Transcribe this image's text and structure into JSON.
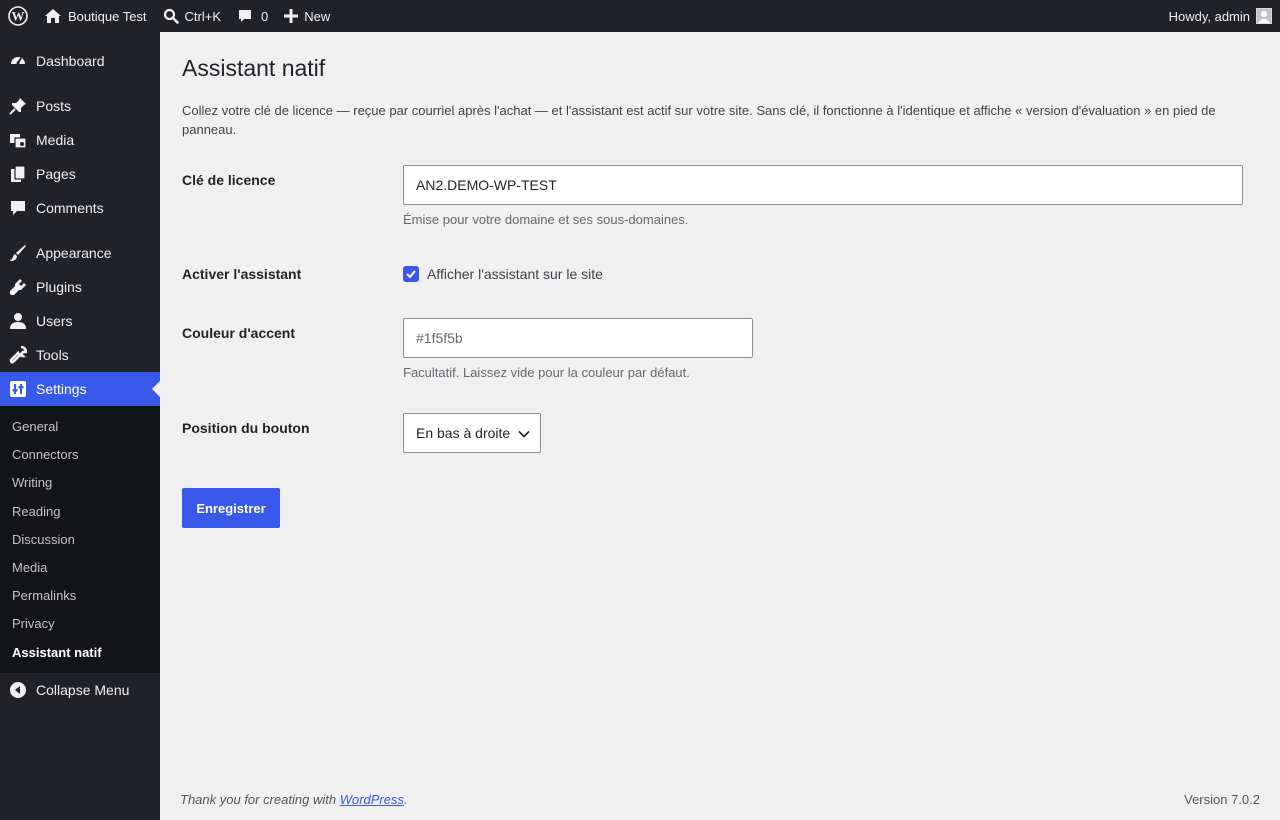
{
  "adminbar": {
    "site_name": "Boutique Test",
    "search_shortcut": "Ctrl+K",
    "comments_count": "0",
    "new_label": "New",
    "howdy": "Howdy, admin"
  },
  "sidebar": {
    "items": [
      {
        "label": "Dashboard",
        "icon": "dashboard-icon"
      },
      {
        "label": "Posts",
        "icon": "pin-icon"
      },
      {
        "label": "Media",
        "icon": "media-icon"
      },
      {
        "label": "Pages",
        "icon": "pages-icon"
      },
      {
        "label": "Comments",
        "icon": "comment-icon"
      },
      {
        "label": "Appearance",
        "icon": "brush-icon"
      },
      {
        "label": "Plugins",
        "icon": "plugin-icon"
      },
      {
        "label": "Users",
        "icon": "user-icon"
      },
      {
        "label": "Tools",
        "icon": "wrench-icon"
      },
      {
        "label": "Settings",
        "icon": "settings-icon"
      }
    ],
    "submenu": [
      "General",
      "Connectors",
      "Writing",
      "Reading",
      "Discussion",
      "Media",
      "Permalinks",
      "Privacy",
      "Assistant natif"
    ],
    "collapse": "Collapse Menu"
  },
  "page": {
    "title": "Assistant natif",
    "intro": "Collez votre clé de licence — reçue par courriel après l'achat — et l'assistant est actif sur votre site. Sans clé, il fonctionne à l'identique et affiche « version d'évaluation » en pied de panneau."
  },
  "form": {
    "license": {
      "label": "Clé de licence",
      "value": "AN2.DEMO-WP-TEST",
      "description": "Émise pour votre domaine et ses sous-domaines."
    },
    "activate": {
      "label": "Activer l'assistant",
      "checkbox_label": "Afficher l'assistant sur le site",
      "checked": true
    },
    "accent": {
      "label": "Couleur d'accent",
      "placeholder": "#1f5f5b",
      "description": "Facultatif. Laissez vide pour la couleur par défaut."
    },
    "position": {
      "label": "Position du bouton",
      "selected": "En bas à droite"
    },
    "submit_label": "Enregistrer"
  },
  "footer": {
    "thanks_prefix": "Thank you for creating with ",
    "wordpress_link": "WordPress",
    "thanks_suffix": ".",
    "version": "Version 7.0.2"
  },
  "colors": {
    "accent": "#3858e9",
    "adminbar_bg": "#1d2327",
    "page_bg": "#f0f0f1"
  }
}
